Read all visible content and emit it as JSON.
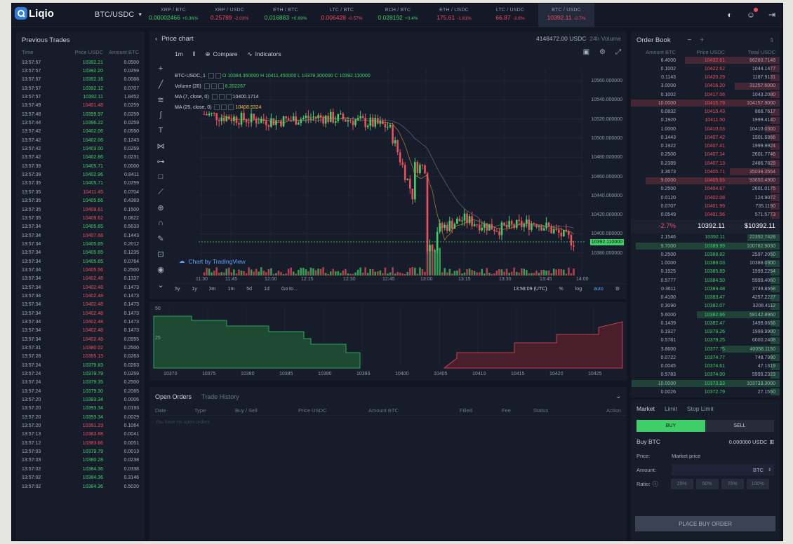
{
  "app": {
    "logo_text": "Liqio",
    "pair": "BTC/USDC"
  },
  "tickers": [
    {
      "name": "XRP / BTC",
      "price": "0.00002466",
      "change": "+0.36%",
      "dir": "g"
    },
    {
      "name": "XRP / USDC",
      "price": "0.25789",
      "change": "-2.03%",
      "dir": "r"
    },
    {
      "name": "ETH / BTC",
      "price": "0.016883",
      "change": "+0.69%",
      "dir": "g"
    },
    {
      "name": "LTC / BTC",
      "price": "0.006428",
      "change": "-0.57%",
      "dir": "r"
    },
    {
      "name": "BCH / BTC",
      "price": "0.028192",
      "change": "+0.4%",
      "dir": "g"
    },
    {
      "name": "ETH / USDC",
      "price": "175.61",
      "change": "-1.81%",
      "dir": "r"
    },
    {
      "name": "LTC / USDC",
      "price": "66.87",
      "change": "-3.6%",
      "dir": "r"
    },
    {
      "name": "BTC / USDC",
      "price": "10392.11",
      "change": "-2.7%",
      "dir": "r"
    }
  ],
  "trades": {
    "title": "Previous Trades",
    "cols": [
      "Time",
      "Price USDC",
      "Amount BTC"
    ],
    "rows": [
      [
        "13:57:57",
        "10392.21",
        "0.0500",
        "g"
      ],
      [
        "13:57:57",
        "10392.20",
        "0.0259",
        "g"
      ],
      [
        "13:57:57",
        "10392.16",
        "0.0088",
        "g"
      ],
      [
        "13:57:57",
        "10392.12",
        "0.0707",
        "g"
      ],
      [
        "13:57:57",
        "10392.11",
        "1.8452",
        "g"
      ],
      [
        "13:57:49",
        "10401.48",
        "0.0259",
        "r"
      ],
      [
        "13:57:48",
        "10399.97",
        "0.0259",
        "g"
      ],
      [
        "13:57:44",
        "10396.22",
        "0.0259",
        "g"
      ],
      [
        "13:57:42",
        "10402.06",
        "0.0550",
        "g"
      ],
      [
        "13:57:42",
        "10402.06",
        "0.1243",
        "g"
      ],
      [
        "13:57:42",
        "10403.00",
        "0.0259",
        "g"
      ],
      [
        "13:57:42",
        "10402.86",
        "0.0231",
        "g"
      ],
      [
        "13:57:39",
        "10405.71",
        "0.0000",
        "g"
      ],
      [
        "13:57:39",
        "10402.96",
        "0.8411",
        "g"
      ],
      [
        "13:57:35",
        "10405.71",
        "0.0259",
        "g"
      ],
      [
        "13:57:35",
        "10411.45",
        "0.0704",
        "r"
      ],
      [
        "13:57:35",
        "10405.66",
        "0.4383",
        "g"
      ],
      [
        "13:57:35",
        "10409.61",
        "0.1500",
        "r"
      ],
      [
        "13:57:35",
        "10409.62",
        "0.0822",
        "r"
      ],
      [
        "13:57:34",
        "10405.65",
        "0.5633",
        "g"
      ],
      [
        "13:57:34",
        "10407.68",
        "0.1443",
        "r"
      ],
      [
        "13:57:34",
        "10405.65",
        "0.2012",
        "g"
      ],
      [
        "13:57:34",
        "10405.65",
        "0.1235",
        "g"
      ],
      [
        "13:57:34",
        "10405.65",
        "0.0764",
        "g"
      ],
      [
        "13:57:34",
        "10405.56",
        "0.2500",
        "r"
      ],
      [
        "13:57:34",
        "10402.48",
        "0.1337",
        "r"
      ],
      [
        "13:57:34",
        "10402.48",
        "0.1473",
        "r"
      ],
      [
        "13:57:34",
        "10402.48",
        "0.1473",
        "r"
      ],
      [
        "13:57:34",
        "10402.48",
        "0.1473",
        "r"
      ],
      [
        "13:57:34",
        "10402.48",
        "0.1473",
        "r"
      ],
      [
        "13:57:34",
        "10402.48",
        "0.1473",
        "r"
      ],
      [
        "13:57:34",
        "10402.48",
        "0.1473",
        "r"
      ],
      [
        "13:57:34",
        "10402.48",
        "0.0955",
        "r"
      ],
      [
        "13:57:31",
        "10380.02",
        "0.2500",
        "r"
      ],
      [
        "13:57:28",
        "10395.13",
        "0.0263",
        "r"
      ],
      [
        "13:57:24",
        "10379.83",
        "0.0263",
        "g"
      ],
      [
        "13:57:24",
        "10379.79",
        "0.0259",
        "g"
      ],
      [
        "13:57:24",
        "10379.35",
        "0.2500",
        "g"
      ],
      [
        "13:57:24",
        "10379.30",
        "0.2085",
        "g"
      ],
      [
        "13:57:20",
        "10393.34",
        "0.0006",
        "g"
      ],
      [
        "13:57:20",
        "10393.34",
        "0.0193",
        "g"
      ],
      [
        "13:57:20",
        "10393.34",
        "0.0029",
        "g"
      ],
      [
        "13:57:20",
        "10391.23",
        "0.1064",
        "r"
      ],
      [
        "13:57:13",
        "10383.88",
        "0.0041",
        "r"
      ],
      [
        "13:57:12",
        "10383.66",
        "0.0051",
        "r"
      ],
      [
        "13:57:03",
        "10379.79",
        "0.0013",
        "g"
      ],
      [
        "13:57:03",
        "10380.28",
        "0.0238",
        "g"
      ],
      [
        "13:57:02",
        "10384.36",
        "0.0338",
        "g"
      ],
      [
        "13:57:02",
        "10384.36",
        "0.3146",
        "g"
      ],
      [
        "13:57:02",
        "10384.36",
        "0.5020",
        "g"
      ]
    ]
  },
  "chart": {
    "title": "Price chart",
    "volume_24h": "4148472.00 USDC",
    "volume_label": "24h Volume",
    "interval": "1m",
    "compare": "Compare",
    "indicators": "Indicators",
    "symbol": "BTC-USDC, 1",
    "ohlc": "O 10384.360000  H 10411.450000  L 10379.300000  C 10392.110000",
    "volume_legend": "Volume (20)",
    "volume_value": "8.202267",
    "ma1_label": "MA (7, close, 0)",
    "ma1_value": "10400.1714",
    "ma2_label": "MA (25, close, 0)",
    "ma2_value": "10408.5324",
    "tv_label": "Chart by TradingView",
    "last_price_tag": "10392.110000",
    "yaxis": [
      "10560.000000",
      "10540.000000",
      "10520.000000",
      "10500.000000",
      "10480.000000",
      "10460.000000",
      "10440.000000",
      "10420.000000",
      "10400.000000",
      "10380.000000"
    ],
    "xaxis": [
      "11:30",
      "11:45",
      "12:00",
      "12:15",
      "12:30",
      "12:45",
      "13:00",
      "13:15",
      "13:30",
      "13:45",
      "14:00"
    ],
    "ranges": [
      "5y",
      "1y",
      "3m",
      "1m",
      "5d",
      "1d",
      "Go to..."
    ],
    "clock": "13:58:09 (UTC)",
    "pct": "%",
    "log": "log",
    "auto": "auto"
  },
  "chart_data": {
    "type": "line",
    "title": "",
    "x": [
      "11:30",
      "11:45",
      "12:00",
      "12:15",
      "12:30",
      "12:45",
      "13:00",
      "13:15",
      "13:30",
      "13:45",
      "14:00"
    ],
    "series": [
      {
        "values": [
          10525,
          10520,
          10518,
          10522,
          10519,
          10512,
          10400,
          10415,
          10405,
          10412,
          10392
        ]
      }
    ],
    "ylim": [
      10375,
      10565
    ]
  },
  "depth": {
    "y_labels": [
      "50",
      "25"
    ],
    "x_labels": [
      "10370",
      "10375",
      "10380",
      "10385",
      "10390",
      "10395",
      "10400",
      "10405",
      "10410",
      "10415",
      "10420",
      "10425"
    ]
  },
  "orders": {
    "tabs": [
      "Open Orders",
      "Trade History"
    ],
    "cols": [
      "Date",
      "Type",
      "Buy / Sell",
      "Price USDC",
      "Amount BTC",
      "Filled",
      "Fee",
      "Status",
      "Action"
    ],
    "empty": "You have no open orders"
  },
  "orderbook": {
    "title": "Order Book",
    "minus": "−",
    "plus": "+",
    "cols": [
      "Amount BTC",
      "Price USDC",
      "Total USDC"
    ],
    "asks": [
      [
        "6.4000",
        "10432.61",
        "66283.7148"
      ],
      [
        "0.1002",
        "10422.62",
        "1044.1477"
      ],
      [
        "0.1143",
        "10420.29",
        "1187.9131"
      ],
      [
        "3.0000",
        "10416.20",
        "31257.6000"
      ],
      [
        "0.1002",
        "10417.06",
        "1043.2080"
      ],
      [
        "10.0000",
        "10415.79",
        "104157.9000"
      ],
      [
        "0.0832",
        "10415.43",
        "866.7617"
      ],
      [
        "0.1920",
        "10411.50",
        "1999.4140"
      ],
      [
        "1.0000",
        "10410.03",
        "10410.0300"
      ],
      [
        "0.1443",
        "10407.42",
        "1501.6866"
      ],
      [
        "0.1922",
        "10407.41",
        "1999.9924"
      ],
      [
        "0.2500",
        "10407.14",
        "2601.7746"
      ],
      [
        "0.2389",
        "10407.13",
        "2486.7828"
      ],
      [
        "3.3673",
        "10405.71",
        "35039.3554"
      ],
      [
        "9.0000",
        "10405.65",
        "93650.4900"
      ],
      [
        "0.2500",
        "10404.67",
        "2601.0175"
      ],
      [
        "0.0120",
        "10402.08",
        "124.9072"
      ],
      [
        "0.0707",
        "10401.99",
        "735.1190"
      ],
      [
        "0.0549",
        "10401.56",
        "571.5773"
      ]
    ],
    "spread_change": "-2.7%",
    "last_price": "10392.11",
    "last_price_usd": "$10392.11",
    "bids": [
      [
        "2.1546",
        "10392.11",
        "22392.7428"
      ],
      [
        "9.7000",
        "10389.99",
        "100782.9030"
      ],
      [
        "0.2500",
        "10388.82",
        "2597.2050"
      ],
      [
        "1.0000",
        "10388.03",
        "10388.0300"
      ],
      [
        "0.1925",
        "10385.89",
        "1999.2254"
      ],
      [
        "0.5777",
        "10384.50",
        "5999.4060"
      ],
      [
        "0.3611",
        "10383.48",
        "3749.8658"
      ],
      [
        "0.4100",
        "10383.47",
        "4257.2227"
      ],
      [
        "0.3090",
        "10382.07",
        "3208.4112"
      ],
      [
        "5.6000",
        "10382.66",
        "58142.8960"
      ],
      [
        "0.1439",
        "10382.47",
        "1498.0656"
      ],
      [
        "0.1927",
        "10379.26",
        "1999.9900"
      ],
      [
        "0.5781",
        "10379.25",
        "6000.2408"
      ],
      [
        "3.8600",
        "10377.75",
        "40058.1150"
      ],
      [
        "0.0722",
        "10374.77",
        "748.7990"
      ],
      [
        "0.0045",
        "10374.61",
        "47.1319"
      ],
      [
        "0.5783",
        "10374.00",
        "5999.2323"
      ],
      [
        "10.0000",
        "10373.93",
        "103739.3000"
      ],
      [
        "0.0026",
        "10372.79",
        "27.1550"
      ]
    ]
  },
  "trade_form": {
    "tabs": [
      "Market",
      "Limit",
      "Stop Limit"
    ],
    "buy": "BUY",
    "sell": "SELL",
    "heading": "Buy BTC",
    "balance": "0.000000 USDC",
    "price_label": "Price:",
    "price_value": "Market price",
    "amount_label": "Amount:",
    "amount_unit": "BTC",
    "ratio_label": "Ratio:",
    "ratios": [
      "25%",
      "50%",
      "75%",
      "100%"
    ],
    "place": "PLACE BUY ORDER"
  }
}
